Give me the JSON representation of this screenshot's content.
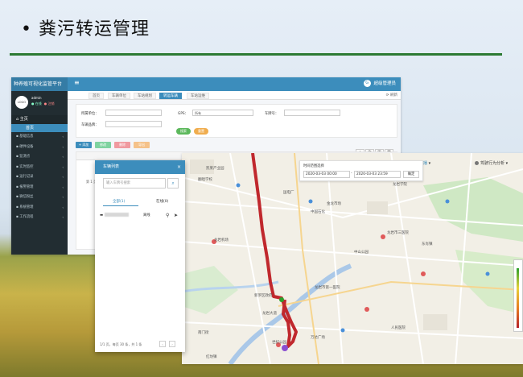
{
  "slide": {
    "title": "• 粪污转运管理",
    "accent": "#2c7a33"
  },
  "app": {
    "brand": "种养殖可视化监管平台",
    "menu_icon": "≡",
    "top_logo_mark": "G",
    "top_logo_text": "超级管理员",
    "user": {
      "avatar_text": "LOGO",
      "name": "admin",
      "online": "● 在线",
      "offline": "● 注销"
    },
    "nav_head": "主页",
    "nav_active": "首页",
    "nav_items": [
      {
        "label": "基础信息"
      },
      {
        "label": "硬件设备"
      },
      {
        "label": "监测点"
      },
      {
        "label": "实时监控"
      },
      {
        "label": "运行记录"
      },
      {
        "label": "报警管理"
      },
      {
        "label": "微信粉丝"
      },
      {
        "label": "系统管理"
      },
      {
        "label": "工作流程"
      }
    ],
    "tabs": [
      "首页",
      "车辆单位",
      "车站规划",
      "转运车辆",
      "车站运维"
    ],
    "tab_refresh": "刷新",
    "filters": {
      "unit_label": "所属单位：",
      "gps_label": "GPS：",
      "gps_value": "所有",
      "plate_label": "车牌号：",
      "brand_label": "车辆品牌：",
      "search_btn": "搜索",
      "reset_btn": "重置"
    },
    "toolbar": {
      "add": "+ 添加",
      "edit": "修改",
      "delete": "删除",
      "export": "导出"
    },
    "table_page_text": "第 1 页"
  },
  "map": {
    "track_btn": "轨迹回播",
    "analysis_btn": "驾驶行为分析",
    "time_label": "时间范围选择",
    "start_time": "2020-03-03 00:00",
    "end_time": "2020-03-03 23:59",
    "confirm": "确定",
    "track_color": "#c0282d",
    "place_labels": [
      "凯莱产业园",
      "翻唱学校",
      "国电厂",
      "龙岩机场",
      "金龙市场",
      "龙岩学院",
      "中国石化",
      "龙岩市三医院",
      "中山公园",
      "龙岩市第一医院",
      "新罗区政府",
      "东肖镇",
      "龙岩大道",
      "南门街",
      "万达广场",
      "人民医院",
      "世纪公园",
      "红坊镇"
    ]
  },
  "dialog": {
    "title": "车辆列表",
    "close": "×",
    "search_placeholder": "输入车牌号搜索",
    "tab_all": "全部(1)",
    "tab_online": "在线(0)",
    "row_status": "离线",
    "footer": "1/1 页，每页 30 条，共 1 条"
  }
}
